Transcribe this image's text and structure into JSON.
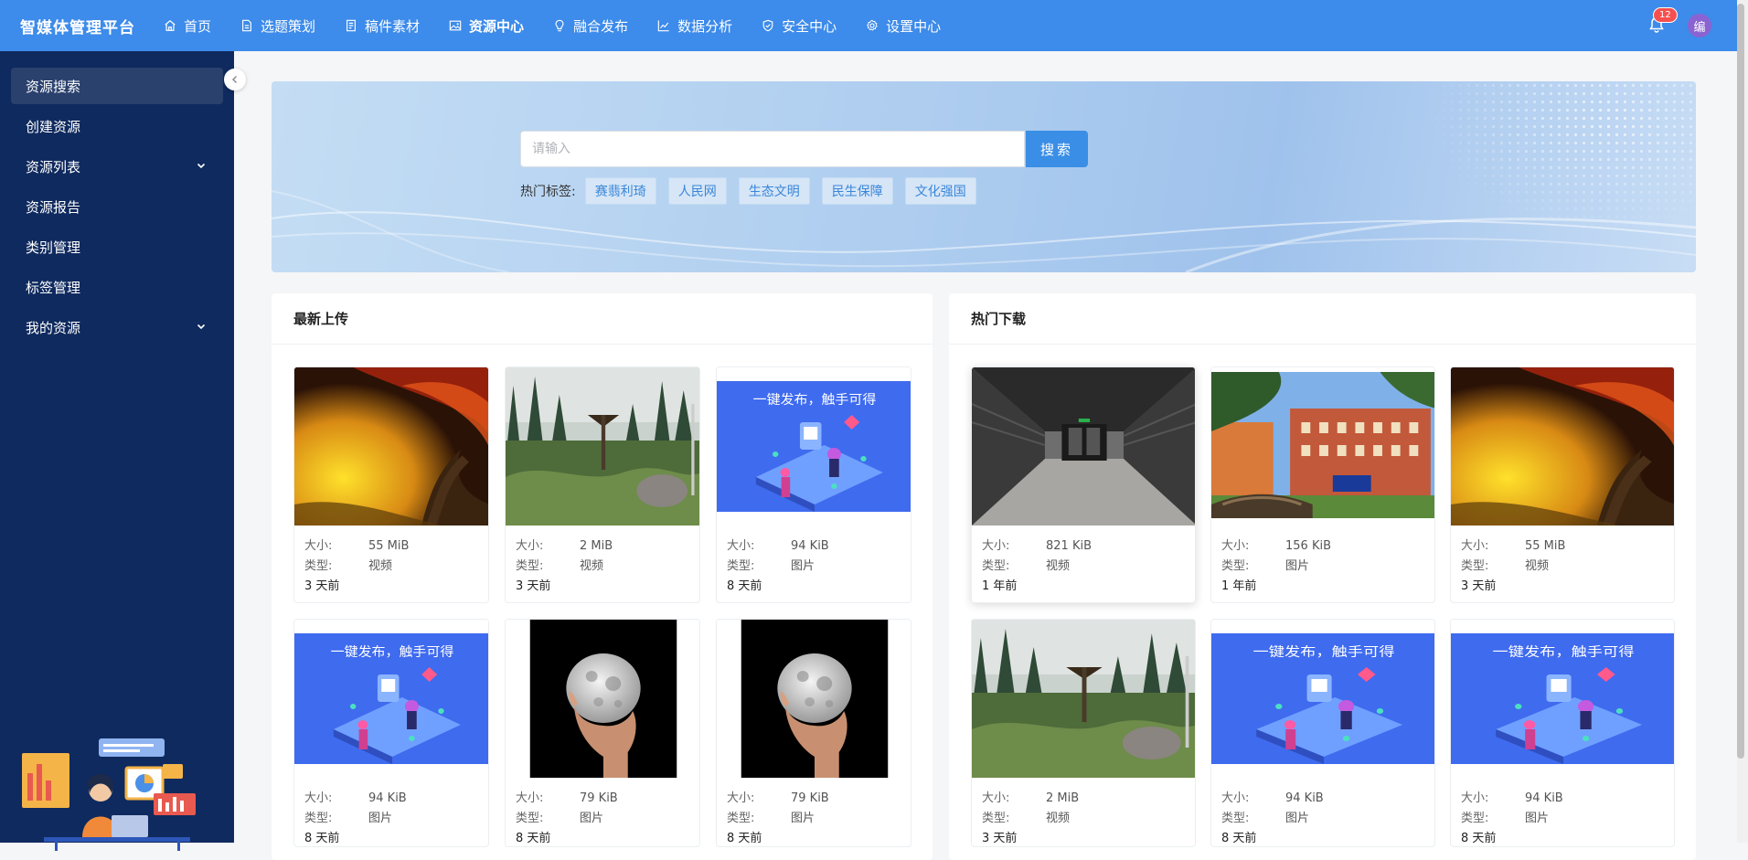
{
  "app": {
    "title": "智媒体管理平台",
    "notifications": "12",
    "avatar": "编"
  },
  "nav": [
    {
      "label": "首页",
      "icon": "home-icon"
    },
    {
      "label": "选题策划",
      "icon": "doc-icon"
    },
    {
      "label": "稿件素材",
      "icon": "file-icon"
    },
    {
      "label": "资源中心",
      "icon": "image-icon",
      "active": true
    },
    {
      "label": "融合发布",
      "icon": "bulb-icon"
    },
    {
      "label": "数据分析",
      "icon": "chart-icon"
    },
    {
      "label": "安全中心",
      "icon": "shield-icon"
    },
    {
      "label": "设置中心",
      "icon": "gear-icon"
    }
  ],
  "sidebar": {
    "items": [
      {
        "label": "资源搜索",
        "active": true
      },
      {
        "label": "创建资源"
      },
      {
        "label": "资源列表",
        "expandable": true
      },
      {
        "label": "资源报告"
      },
      {
        "label": "类别管理"
      },
      {
        "label": "标签管理"
      },
      {
        "label": "我的资源",
        "expandable": true
      }
    ]
  },
  "search": {
    "placeholder": "请输入",
    "button": "搜索",
    "hot_label": "热门标签:",
    "tags": [
      "赛翡利琦",
      "人民网",
      "生态文明",
      "民生保障",
      "文化强国"
    ]
  },
  "latest": {
    "title": "最新上传",
    "size_key": "大小:",
    "type_key": "类型:",
    "cards": [
      {
        "image": "autumn-tree",
        "size": "55 MiB",
        "type": "视频",
        "time": "3 天前"
      },
      {
        "image": "forest-tower",
        "size": "2 MiB",
        "type": "视频",
        "time": "3 天前"
      },
      {
        "image": "publish-promo",
        "size": "94 KiB",
        "type": "图片",
        "time": "8 天前"
      },
      {
        "image": "publish-promo",
        "size": "94 KiB",
        "type": "图片",
        "time": "8 天前"
      },
      {
        "image": "moon-hand",
        "size": "79 KiB",
        "type": "图片",
        "time": "8 天前"
      },
      {
        "image": "moon-hand",
        "size": "79 KiB",
        "type": "图片",
        "time": "8 天前"
      }
    ]
  },
  "hot": {
    "title": "热门下载",
    "size_key": "大小:",
    "type_key": "类型:",
    "cards": [
      {
        "image": "corridor",
        "size": "821 KiB",
        "type": "视频",
        "time": "1 年前"
      },
      {
        "image": "campus-building",
        "size": "156 KiB",
        "type": "图片",
        "time": "1 年前"
      },
      {
        "image": "autumn-tree",
        "size": "55 MiB",
        "type": "视频",
        "time": "3 天前"
      },
      {
        "image": "forest-tower",
        "size": "2 MiB",
        "type": "视频",
        "time": "3 天前"
      },
      {
        "image": "publish-promo",
        "size": "94 KiB",
        "type": "图片",
        "time": "8 天前"
      },
      {
        "image": "publish-promo",
        "size": "94 KiB",
        "type": "图片",
        "time": "8 天前"
      }
    ]
  },
  "promo_text": "一键发布，触手可得",
  "colors": {
    "topbar": "#3d8bea",
    "sidebar": "#0f2a5e",
    "accent": "#3a8ee6",
    "badge": "#f5504f"
  }
}
